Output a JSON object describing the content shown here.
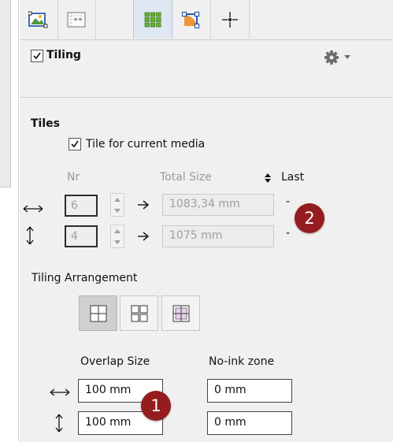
{
  "header": {
    "tiling_label": "Tiling",
    "tiling_checked": true,
    "settings_icon": "gear-dropdown-icon"
  },
  "tabs": [
    {
      "icon": "image-edit-icon",
      "active": false
    },
    {
      "icon": "layout-icon",
      "active": false
    },
    {
      "icon": "tiling-grid-icon",
      "active": true
    },
    {
      "icon": "curve-fill-icon",
      "active": false
    },
    {
      "icon": "crosshair-icon",
      "active": false
    }
  ],
  "tiles": {
    "heading": "Tiles",
    "current_media_label": "Tile for current media",
    "current_media_checked": true,
    "col_nr": "Nr",
    "col_total_size": "Total Size",
    "col_last": "Last",
    "rows": [
      {
        "nr": "6",
        "total": "1083,34 mm",
        "last": "-"
      },
      {
        "nr": "4",
        "total": "1075 mm",
        "last": "-"
      }
    ]
  },
  "arrangement": {
    "label": "Tiling Arrangement",
    "options": [
      {
        "icon": "grid-arrangement-1-icon",
        "selected": true
      },
      {
        "icon": "grid-arrangement-2-icon",
        "selected": false
      },
      {
        "icon": "grid-arrangement-3-icon",
        "selected": false
      }
    ]
  },
  "overlap": {
    "label": "Overlap Size",
    "horizontal": "100 mm",
    "vertical": "100 mm"
  },
  "noink": {
    "label": "No-ink zone",
    "horizontal": "0 mm",
    "vertical": "0 mm"
  },
  "callouts": [
    "1",
    "2"
  ],
  "colors": {
    "callout": "#951d1f",
    "active_tab": "#dfe7f3",
    "panel": "#f0f0f0"
  }
}
